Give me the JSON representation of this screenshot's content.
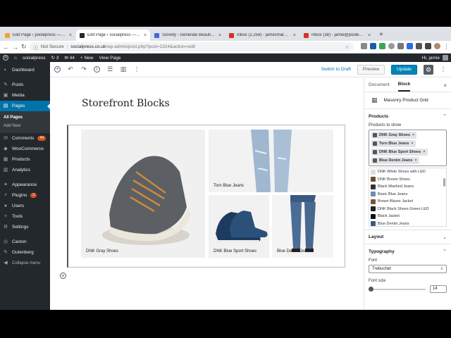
{
  "browser": {
    "tabs": [
      {
        "title": "Edit Page ‹ poolepress — Wo",
        "fav_color": "#f0a23b",
        "active": false
      },
      {
        "title": "Edit Page ‹ socialpress — Wo",
        "fav_color": "#23282d",
        "active": true
      },
      {
        "title": "Screely - Generate Beautiful M",
        "fav_color": "#4169e1",
        "active": false
      },
      {
        "title": "Inbox (2,259) - jamesmarsland",
        "fav_color": "#d93025",
        "active": false
      },
      {
        "title": "Inbox (38) - jamie@poolepress",
        "fav_color": "#d93025",
        "active": false
      }
    ],
    "new_tab": "+",
    "not_secure": "Not Secure",
    "url_domain": "socialpress.co.uk",
    "url_path": "/wp-admin/post.php?post=1324&action=edit"
  },
  "adminbar": {
    "site": "socialpress",
    "updates": "3",
    "comments": "44",
    "new": "New",
    "view_page": "View Page",
    "greeting": "Hi, jamie"
  },
  "sidebar": {
    "items": [
      {
        "label": "Dashboard",
        "icon": "dashboard-icon",
        "glyph": "◐"
      },
      {
        "label": "Posts",
        "icon": "pin-icon",
        "glyph": "✎"
      },
      {
        "label": "Media",
        "icon": "media-icon",
        "glyph": "▣"
      },
      {
        "label": "Pages",
        "icon": "pages-icon",
        "glyph": "▤"
      }
    ],
    "sub": {
      "all": "All Pages",
      "add": "Add New"
    },
    "items2": [
      {
        "label": "Comments",
        "icon": "comments-icon",
        "glyph": "✉",
        "badge": "44"
      },
      {
        "label": "WooCommerce",
        "icon": "woocommerce-icon",
        "glyph": "◆"
      },
      {
        "label": "Products",
        "icon": "products-icon",
        "glyph": "▦"
      },
      {
        "label": "Analytics",
        "icon": "analytics-icon",
        "glyph": "▥"
      }
    ],
    "items3": [
      {
        "label": "Appearance",
        "icon": "appearance-icon",
        "glyph": "✦"
      },
      {
        "label": "Plugins",
        "icon": "plugins-icon",
        "glyph": "⚡",
        "badge": "2"
      },
      {
        "label": "Users",
        "icon": "users-icon",
        "glyph": "●"
      },
      {
        "label": "Tools",
        "icon": "tools-icon",
        "glyph": "✧"
      },
      {
        "label": "Settings",
        "icon": "settings-icon",
        "glyph": "⚙"
      }
    ],
    "items4": [
      {
        "label": "Caxton",
        "icon": "caxton-icon",
        "glyph": "◎"
      },
      {
        "label": "Gutenberg",
        "icon": "gutenberg-icon",
        "glyph": "✎"
      },
      {
        "label": "Collapse menu",
        "icon": "collapse-icon",
        "glyph": "◀"
      }
    ]
  },
  "toolbar": {
    "switch_draft": "Switch to Draft",
    "preview": "Preview",
    "update": "Update"
  },
  "content": {
    "title": "Storefront Blocks",
    "products": [
      {
        "caption": "DNK Gray Shoes"
      },
      {
        "caption": "Torn Blue Jeans"
      },
      {
        "caption": "DNK Blue Sport Shoes"
      },
      {
        "caption": "Blue Denim Jeans"
      }
    ]
  },
  "panel": {
    "tab_document": "Document",
    "tab_block": "Block",
    "block_name": "Masonry Product Grid",
    "products_heading": "Products",
    "products_label": "Products to show",
    "tokens": [
      "DNK Gray Shoes",
      "Torn Blue Jeans",
      "DNK Blue Sport Shoes",
      "Blue Denim Jeans"
    ],
    "suggestions": [
      "DNK White Shoes with LED",
      "DNK Brown Shoes",
      "Black Washed Jeans",
      "Basic Blue Jeans",
      "Brown Blazer Jacket",
      "DNK Black Shoes Green LED",
      "Black Jacket",
      "Blue Denim Jeans"
    ],
    "layout_heading": "Layout",
    "typography_heading": "Typography",
    "font_label": "Font",
    "font_value": "Trebuchet",
    "font_size_label": "Font size",
    "font_size_value": "14"
  }
}
